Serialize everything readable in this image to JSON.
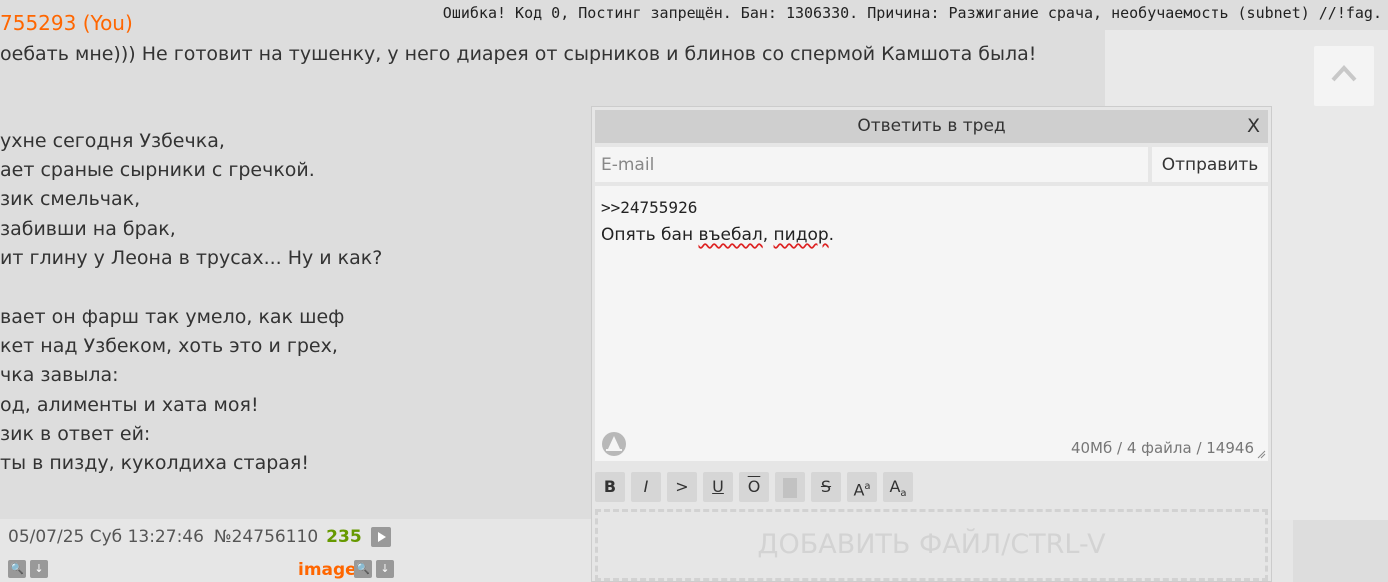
{
  "error_message": "Ошибка! Код 0, Постинг запрещён. Бан: 1306330. Причина: Разжигание срача, необучаемость (subnet) //!fag.",
  "post": {
    "author_fragment": "755293 (You)",
    "lines": [
      "оебать мне))) Не готовит на тушенку, у него диарея от сырников и блинов со спермой Камшота была!",
      "",
      "ухне сегодня Узбечка,",
      "ает сраные сырники с гречкой.",
      "зик смельчак,",
      "забивши на брак,",
      "ит глину у Леона в трусах... Ну и как?",
      "",
      "вает он фарш так умело, как шеф",
      "кет над Узбеком, хоть это и грех,",
      "чка завыла:",
      "од, алименты и хата моя!",
      "зик в ответ ей:",
      "ты в пизду, куколдиха старая!"
    ],
    "meta_date": "05/07/25 Суб 13:27:46",
    "meta_number": "№24756110",
    "meta_views": "235",
    "image_label": "image"
  },
  "reply_form": {
    "title": "Ответить в тред",
    "close_label": "X",
    "email_placeholder": "E-mail",
    "submit_label": "Отправить",
    "text_line1": ">>24755926",
    "text_line2_before": "Опять бан ",
    "text_line2_word1": "въебал",
    "text_line2_mid": ", ",
    "text_line2_word2": "пидор",
    "text_line2_after": ".",
    "counter": "40Мб / 4 файла / 14946",
    "markup_buttons": [
      {
        "label": "B",
        "kind": "bold"
      },
      {
        "label": "I",
        "kind": "italic"
      },
      {
        "label": ">",
        "kind": "quote"
      },
      {
        "label": "U",
        "kind": "underline"
      },
      {
        "label": "O",
        "kind": "overline"
      },
      {
        "label": "",
        "kind": "spoiler"
      },
      {
        "label": "S",
        "kind": "strike"
      },
      {
        "label": "A",
        "kind": "sup"
      },
      {
        "label": "A",
        "kind": "sub"
      }
    ],
    "dropzone_label": "ДОБАВИТЬ ФАЙЛ/CTRL-V"
  },
  "colors": {
    "accent": "#ff6600",
    "views": "#669900",
    "background": "#dddddd"
  }
}
